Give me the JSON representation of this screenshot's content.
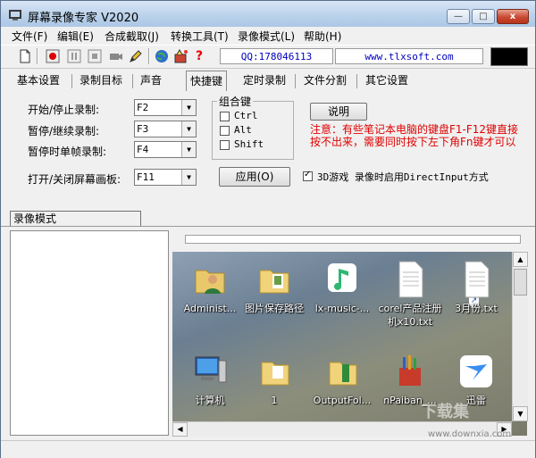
{
  "window": {
    "title": "屏幕录像专家 V2020",
    "controls": {
      "minimize": "—",
      "maximize": "□",
      "close": "x"
    }
  },
  "menu": [
    "文件(F)",
    "编辑(E)",
    "合成截取(J)",
    "转换工具(T)",
    "录像模式(L)",
    "帮助(H)"
  ],
  "toolbar": {
    "icons": [
      "new-file-icon",
      "record-icon",
      "pause-icon",
      "stop-icon",
      "camera-icon",
      "pen-icon",
      "globe-icon",
      "tool-icon",
      "help-icon"
    ],
    "help_glyph": "?",
    "qq": "QQ:178046113",
    "website": "www.tlxsoft.com"
  },
  "tabs": [
    "基本设置",
    "录制目标",
    "声音",
    "快捷键",
    "定时录制",
    "文件分割",
    "其它设置"
  ],
  "active_tab": "快捷键",
  "hotkeys": {
    "start_stop": {
      "label": "开始/停止录制:",
      "value": "F2"
    },
    "pause_resume": {
      "label": "暂停/继续录制:",
      "value": "F3"
    },
    "pause_single_frame": {
      "label": "暂停时单帧录制:",
      "value": "F4"
    },
    "toggle_canvas": {
      "label": "打开/关闭屏幕画板:",
      "value": "F11"
    }
  },
  "combo_group": {
    "title": "组合键",
    "options": [
      {
        "label": "Ctrl",
        "checked": false
      },
      {
        "label": "Alt",
        "checked": false
      },
      {
        "label": "Shift",
        "checked": false
      }
    ]
  },
  "explain_button": "说明",
  "apply_button": "应用(O)",
  "directinput": {
    "label": "3D游戏 录像时启用DirectInput方式",
    "checked": true
  },
  "note": "注意：有些笔记本电脑的键盘F1-F12键直接按不出来，需要同时按下左下角Fn键才可以",
  "bottom_tab": "录像模式",
  "desktop_icons": [
    {
      "label": "Administ...",
      "icon": "user-folder-icon"
    },
    {
      "label": "图片保存路径",
      "icon": "folder-icon"
    },
    {
      "label": "lx-music-...",
      "icon": "music-app-icon"
    },
    {
      "label": "corel产品注册机x10.txt",
      "icon": "text-file-icon"
    },
    {
      "label": "3月份.txt",
      "icon": "text-file-icon"
    },
    {
      "label": "计算机",
      "icon": "computer-icon"
    },
    {
      "label": "1",
      "icon": "folder-shortcut-icon"
    },
    {
      "label": "OutputFol...",
      "icon": "folder-shortcut-icon"
    },
    {
      "label": "nPaiban_...",
      "icon": "app-shortcut-icon"
    },
    {
      "label": "迅雷",
      "icon": "thunder-app-icon"
    }
  ],
  "watermark": {
    "text": "下载集",
    "url_text": "www.downxia.com"
  },
  "colors": {
    "note_red": "#e00000",
    "link_blue": "#0000c0"
  }
}
